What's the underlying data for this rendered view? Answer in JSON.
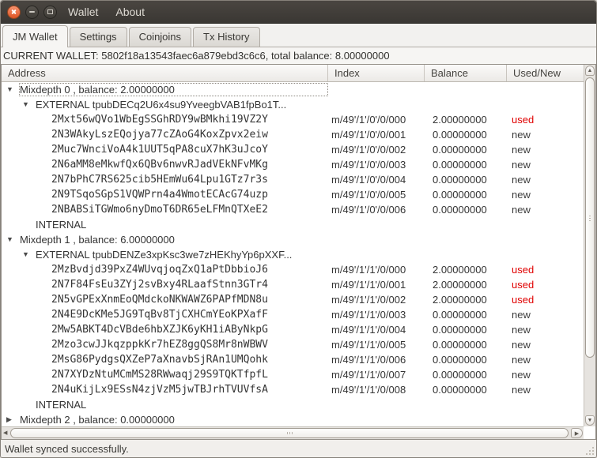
{
  "titlebar": {
    "menu_items": [
      {
        "label": "Wallet"
      },
      {
        "label": "About"
      }
    ]
  },
  "tabs": [
    {
      "label": "JM Wallet",
      "active": true
    },
    {
      "label": "Settings",
      "active": false
    },
    {
      "label": "Coinjoins",
      "active": false
    },
    {
      "label": "Tx History",
      "active": false
    }
  ],
  "wallet_summary": "CURRENT WALLET: 5802f18a13543faec6a879ebd3c6c6, total balance: 8.00000000",
  "tree": {
    "columns": [
      "Address",
      "Index",
      "Balance",
      "Used/New"
    ],
    "rows": [
      {
        "depth": 0,
        "arrow": "down",
        "focused": true,
        "label": "Mixdepth 0 , balance: 2.00000000"
      },
      {
        "depth": 1,
        "arrow": "down",
        "label": "EXTERNAL tpubDECq2U6x4su9YveegbVAB1fpBo1T..."
      },
      {
        "depth": 2,
        "address": "2Mxt56wQVo1WbEgSSGhRDY9wBMkhi19VZ2Y",
        "index": "m/49'/1'/0'/0/000",
        "balance": "2.00000000",
        "status": "used"
      },
      {
        "depth": 2,
        "address": "2N3WAkyLszEQojya77cZAoG4KoxZpvx2eiw",
        "index": "m/49'/1'/0'/0/001",
        "balance": "0.00000000",
        "status": "new"
      },
      {
        "depth": 2,
        "address": "2Muc7WnciVoA4k1UUT5qPA8cuX7hK3uJcoY",
        "index": "m/49'/1'/0'/0/002",
        "balance": "0.00000000",
        "status": "new"
      },
      {
        "depth": 2,
        "address": "2N6aMM8eMkwfQx6QBv6nwvRJadVEkNFvMKg",
        "index": "m/49'/1'/0'/0/003",
        "balance": "0.00000000",
        "status": "new"
      },
      {
        "depth": 2,
        "address": "2N7bPhC7RS625cib5HEmWu64Lpu1GTz7r3s",
        "index": "m/49'/1'/0'/0/004",
        "balance": "0.00000000",
        "status": "new"
      },
      {
        "depth": 2,
        "address": "2N9TSqoSGpS1VQWPrn4a4WmotECAcG74uzp",
        "index": "m/49'/1'/0'/0/005",
        "balance": "0.00000000",
        "status": "new"
      },
      {
        "depth": 2,
        "address": "2NBABSiTGWmo6nyDmoT6DR65eLFMnQTXeE2",
        "index": "m/49'/1'/0'/0/006",
        "balance": "0.00000000",
        "status": "new"
      },
      {
        "depth": 1,
        "label": "INTERNAL"
      },
      {
        "depth": 0,
        "arrow": "down",
        "label": "Mixdepth 1 , balance: 6.00000000"
      },
      {
        "depth": 1,
        "arrow": "down",
        "label": "EXTERNAL tpubDENZe3xpKsc3we7zHEKhyYp6pXXF..."
      },
      {
        "depth": 2,
        "address": "2MzBvdjd39PxZ4WUvqjoqZxQ1aPtDbbioJ6",
        "index": "m/49'/1'/1'/0/000",
        "balance": "2.00000000",
        "status": "used"
      },
      {
        "depth": 2,
        "address": "2N7F84FsEu3ZYj2svBxy4RLaafStnn3GTr4",
        "index": "m/49'/1'/1'/0/001",
        "balance": "2.00000000",
        "status": "used"
      },
      {
        "depth": 2,
        "address": "2N5vGPExXnmEoQMdckoNKWAWZ6PAPfMDN8u",
        "index": "m/49'/1'/1'/0/002",
        "balance": "2.00000000",
        "status": "used"
      },
      {
        "depth": 2,
        "address": "2N4E9DcKMe5JG9TqBv8TjCXHCmYEoKPXafF",
        "index": "m/49'/1'/1'/0/003",
        "balance": "0.00000000",
        "status": "new"
      },
      {
        "depth": 2,
        "address": "2Mw5ABKT4DcVBde6hbXZJK6yKH1iAByNkpG",
        "index": "m/49'/1'/1'/0/004",
        "balance": "0.00000000",
        "status": "new"
      },
      {
        "depth": 2,
        "address": "2Mzo3cwJJkqzppkKr7hEZ8ggQS8Mr8nWBWV",
        "index": "m/49'/1'/1'/0/005",
        "balance": "0.00000000",
        "status": "new"
      },
      {
        "depth": 2,
        "address": "2MsG86PydgsQXZeP7aXnavbSjRAn1UMQohk",
        "index": "m/49'/1'/1'/0/006",
        "balance": "0.00000000",
        "status": "new"
      },
      {
        "depth": 2,
        "address": "2N7XYDzNtuMCmMS28RWwaqj29S9TQKTfpfL",
        "index": "m/49'/1'/1'/0/007",
        "balance": "0.00000000",
        "status": "new"
      },
      {
        "depth": 2,
        "address": "2N4uKijLx9ESsN4zjVzM5jwTBJrhTVUVfsA",
        "index": "m/49'/1'/1'/0/008",
        "balance": "0.00000000",
        "status": "new"
      },
      {
        "depth": 1,
        "label": "INTERNAL"
      },
      {
        "depth": 0,
        "arrow": "right",
        "label": "Mixdepth 2 , balance: 0.00000000"
      }
    ]
  },
  "statusbar": {
    "message": "Wallet synced successfully."
  },
  "icons": {
    "close": "close-icon",
    "minimize": "minimize-icon",
    "maximize": "maximize-icon",
    "expanded": "▼",
    "collapsed": "▶",
    "scroll_up": "▲",
    "scroll_down": "▼",
    "scroll_left": "◀",
    "scroll_right": "▶"
  },
  "colors": {
    "used_status": "#e00000",
    "new_status": "#3c3c3c",
    "titlebar_bg": "#3f3c37",
    "close_button": "#e0551f",
    "tree_bg": "#ffffff"
  }
}
